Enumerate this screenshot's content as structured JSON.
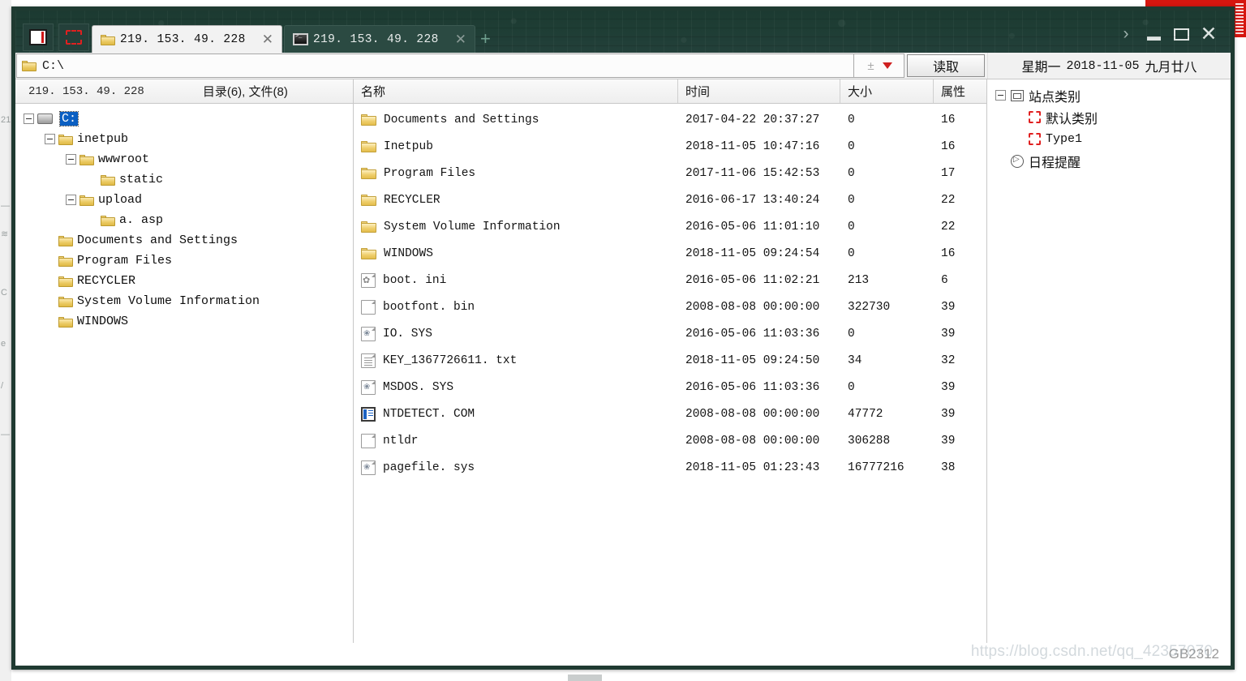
{
  "titlebar": {
    "tool_buttons": [
      {
        "name": "window-icon",
        "icon": "window-square-icon"
      },
      {
        "name": "select-region",
        "icon": "dashed-square-icon"
      }
    ],
    "tabs": [
      {
        "label": "219. 153. 49. 228",
        "icon": "folder-icon",
        "active": true,
        "close": "✕"
      },
      {
        "label": "219. 153. 49. 228",
        "icon": "terminal-icon",
        "active": false,
        "close": "✕"
      }
    ],
    "add_tab": "+",
    "controls": {
      "overflow": "›",
      "minimize": "minimize-icon",
      "maximize": "maximize-icon",
      "close": "✕"
    }
  },
  "addressbar": {
    "path_icon": "folder-icon",
    "path_value": "C:\\",
    "path_placeholder": "C:\\",
    "plusminus_icon": "±",
    "dropdown_icon": "chevron-down-icon",
    "read_button": "读取",
    "date": {
      "weekday": "星期一",
      "gregorian": "2018-11-05",
      "lunar": "九月廿八"
    }
  },
  "left_pane": {
    "host": "219. 153. 49. 228",
    "counts": "目录(6), 文件(8)",
    "tree": [
      {
        "label": "C:",
        "indent": 0,
        "expander": "minus",
        "icon": "drive-icon",
        "selected": true
      },
      {
        "label": "inetpub",
        "indent": 1,
        "expander": "minus",
        "icon": "folder-icon",
        "selected": false
      },
      {
        "label": "wwwroot",
        "indent": 2,
        "expander": "minus",
        "icon": "folder-icon",
        "selected": false
      },
      {
        "label": "static",
        "indent": 3,
        "expander": "none",
        "icon": "folder-icon",
        "selected": false
      },
      {
        "label": "upload",
        "indent": 2,
        "expander": "minus",
        "icon": "folder-icon",
        "selected": false
      },
      {
        "label": "a. asp",
        "indent": 3,
        "expander": "none",
        "icon": "folder-icon",
        "selected": false
      },
      {
        "label": "Documents and Settings",
        "indent": 1,
        "expander": "none",
        "icon": "folder-icon",
        "selected": false
      },
      {
        "label": "Program Files",
        "indent": 1,
        "expander": "none",
        "icon": "folder-icon",
        "selected": false
      },
      {
        "label": "RECYCLER",
        "indent": 1,
        "expander": "none",
        "icon": "folder-icon",
        "selected": false
      },
      {
        "label": "System Volume Information",
        "indent": 1,
        "expander": "none",
        "icon": "folder-icon",
        "selected": false
      },
      {
        "label": "WINDOWS",
        "indent": 1,
        "expander": "none",
        "icon": "folder-icon",
        "selected": false
      }
    ]
  },
  "file_list": {
    "columns": [
      "名称",
      "时间",
      "大小",
      "属性"
    ],
    "rows": [
      {
        "icon": "folder-icon",
        "name": "Documents and Settings",
        "time": "2017-04-22 20:37:27",
        "size": "0",
        "attr": "16"
      },
      {
        "icon": "folder-icon",
        "name": "Inetpub",
        "time": "2018-11-05 10:47:16",
        "size": "0",
        "attr": "16"
      },
      {
        "icon": "folder-icon",
        "name": "Program Files",
        "time": "2017-11-06 15:42:53",
        "size": "0",
        "attr": "17"
      },
      {
        "icon": "folder-icon",
        "name": "RECYCLER",
        "time": "2016-06-17 13:40:24",
        "size": "0",
        "attr": "22"
      },
      {
        "icon": "folder-icon",
        "name": "System Volume Information",
        "time": "2016-05-06 11:01:10",
        "size": "0",
        "attr": "22"
      },
      {
        "icon": "folder-icon",
        "name": "WINDOWS",
        "time": "2018-11-05 09:24:54",
        "size": "0",
        "attr": "16"
      },
      {
        "icon": "gear-file-icon",
        "name": "boot. ini",
        "time": "2016-05-06 11:02:21",
        "size": "213",
        "attr": "6"
      },
      {
        "icon": "blank-file-icon",
        "name": "bootfont. bin",
        "time": "2008-08-08 00:00:00",
        "size": "322730",
        "attr": "39"
      },
      {
        "icon": "system-file-icon",
        "name": "IO. SYS",
        "time": "2016-05-06 11:03:36",
        "size": "0",
        "attr": "39"
      },
      {
        "icon": "text-file-icon",
        "name": "KEY_1367726611. txt",
        "time": "2018-11-05 09:24:50",
        "size": "34",
        "attr": "32"
      },
      {
        "icon": "system-file-icon",
        "name": "MSDOS. SYS",
        "time": "2016-05-06 11:03:36",
        "size": "0",
        "attr": "39"
      },
      {
        "icon": "com-file-icon",
        "name": "NTDETECT. COM",
        "time": "2008-08-08 00:00:00",
        "size": "47772",
        "attr": "39"
      },
      {
        "icon": "blank-file-icon",
        "name": "ntldr",
        "time": "2008-08-08 00:00:00",
        "size": "306288",
        "attr": "39"
      },
      {
        "icon": "system-file-icon",
        "name": "pagefile. sys",
        "time": "2018-11-05 01:23:43",
        "size": "16777216",
        "attr": "38"
      }
    ]
  },
  "right_pane": {
    "tree": [
      {
        "label": "站点类别",
        "indent": 0,
        "expander": "minus",
        "icon": "page-icon",
        "mono": false
      },
      {
        "label": "默认类别",
        "indent": 1,
        "expander": "none",
        "icon": "red-dashed-icon",
        "mono": false
      },
      {
        "label": "Type1",
        "indent": 1,
        "expander": "none",
        "icon": "red-dashed-icon",
        "mono": true
      },
      {
        "label": "日程提醒",
        "indent": 0,
        "expander": "none",
        "icon": "clock-icon",
        "mono": false
      }
    ]
  },
  "statusbar": {
    "encoding": "GB2312"
  },
  "watermark": {
    "text": "https://blog.csdn.net/qq_42357070"
  },
  "colors": {
    "titlebar": "#1e3d34",
    "border": "#1f3a31",
    "accent_red": "#d6160f",
    "selection_blue": "#0b5fc2",
    "folder_yellow": "#e8c357"
  }
}
